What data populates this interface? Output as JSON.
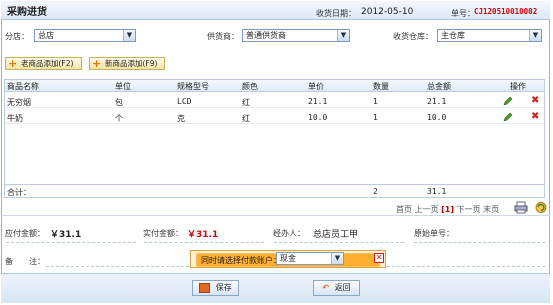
{
  "title": "采购进货",
  "header": {
    "date_label": "收货日期：",
    "date_value": "2012-05-10",
    "order_label": "单号：",
    "order_value": "CJ120510010002"
  },
  "filters": {
    "branch_label": "分店：",
    "branch_value": "总店",
    "supplier_label": "供货商：",
    "supplier_value": "普通供货商",
    "warehouse_label": "收货仓库：",
    "warehouse_value": "主仓库"
  },
  "buttons": {
    "add_old": "老商品添加(F2)",
    "add_new": "新商品添加(F9)",
    "save": "保存",
    "back": "返回"
  },
  "table": {
    "headers": [
      "商品名称",
      "单位",
      "规格型号",
      "颜色",
      "单价",
      "数量",
      "总金额",
      "操作"
    ],
    "rows": [
      [
        "无穷烟",
        "包",
        "LCD",
        "红",
        "21.1",
        "1",
        "21.1"
      ],
      [
        "牛奶",
        "个",
        "克",
        "红",
        "10.0",
        "1",
        "10.0"
      ]
    ],
    "total_label": "合计：",
    "total_qty": "2",
    "total_amount": "31.1"
  },
  "pagination": {
    "first": "首页",
    "prev": "上一页",
    "current": "[1]",
    "next": "下一页",
    "last": "末页"
  },
  "summary": {
    "payable_label": "应付金额：",
    "payable_value": "￥31.1",
    "paid_label": "实付金额：",
    "paid_value": "￥31.1",
    "handler_label": "经办人：",
    "handler_value": "总店员工甲",
    "orig_label": "原始单号：",
    "orig_value": "",
    "remark_label": "备　　注："
  },
  "popup": {
    "label": "同时请选择付款账户：",
    "account_value": "现金"
  },
  "colors": {
    "accent_red": "#dd0000",
    "border_blue": "#8eb2d8"
  }
}
